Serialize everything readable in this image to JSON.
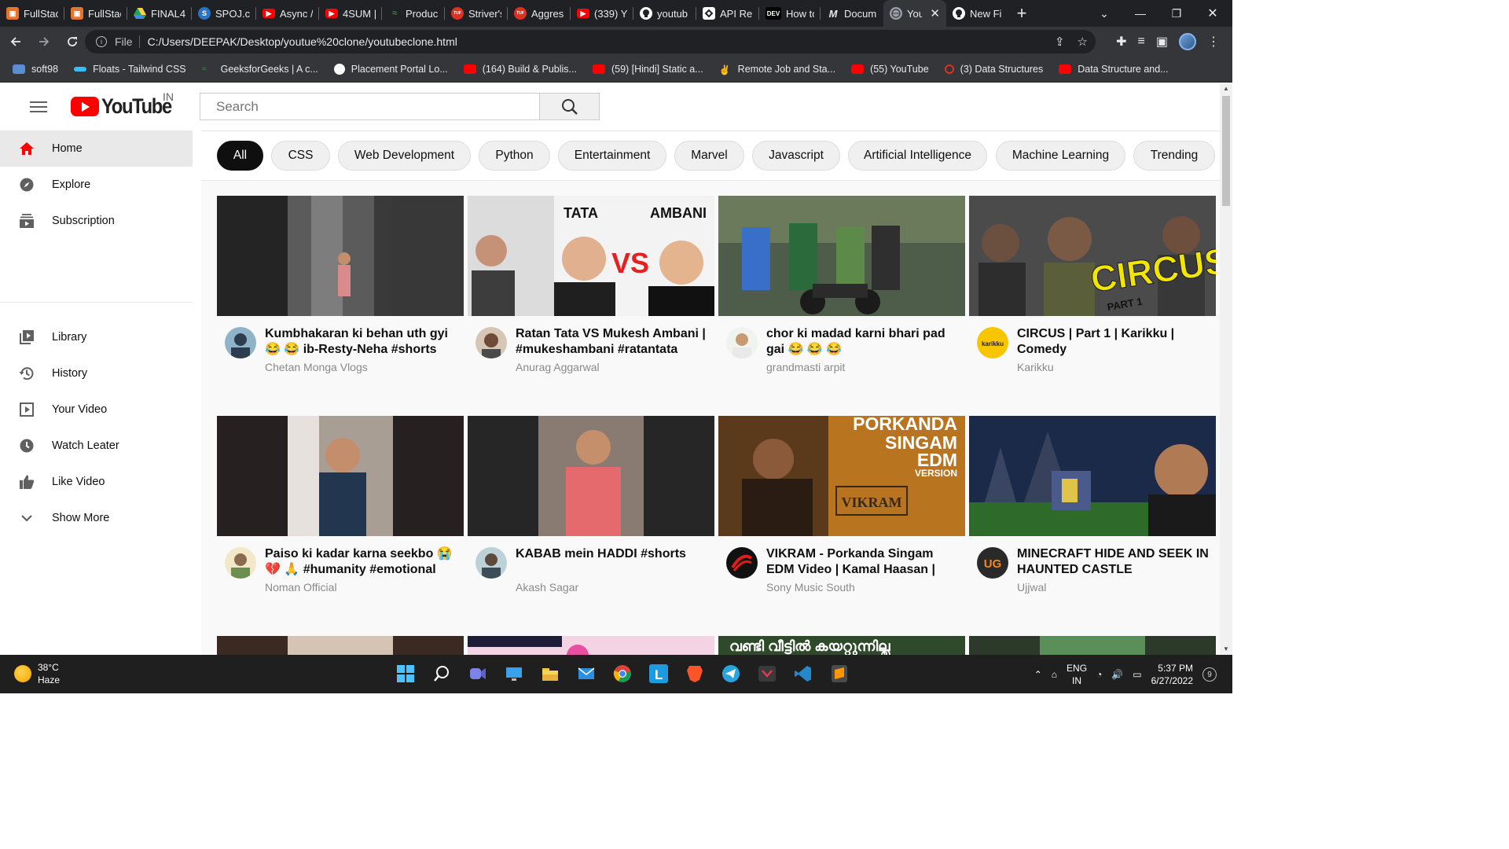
{
  "browser": {
    "tabs": [
      {
        "label": "FullStac",
        "icon": "fullstack-icon",
        "color": "#e8742c"
      },
      {
        "label": "FullStac",
        "icon": "fullstack-icon",
        "color": "#e8742c"
      },
      {
        "label": "FINAL4",
        "icon": "drive-icon",
        "color": "#1fa463"
      },
      {
        "label": "SPOJ.c",
        "icon": "spoj-icon",
        "color": "#2a74c8"
      },
      {
        "label": "Async /",
        "icon": "youtube-icon",
        "color": "#ff0000"
      },
      {
        "label": "4SUM |",
        "icon": "youtube-icon",
        "color": "#ff0000"
      },
      {
        "label": "Produc",
        "icon": "gfg-icon",
        "color": "#2f8d46"
      },
      {
        "label": "Striver's",
        "icon": "tuf-icon",
        "color": "#e0301e"
      },
      {
        "label": "Aggres",
        "icon": "tuf-icon",
        "color": "#e0301e"
      },
      {
        "label": "(339) Y",
        "icon": "youtube-icon",
        "color": "#ff0000"
      },
      {
        "label": "youtub",
        "icon": "github-icon",
        "color": "#ffffff"
      },
      {
        "label": "API Re",
        "icon": "api-icon",
        "color": "#ffffff"
      },
      {
        "label": "How to",
        "icon": "dev-icon",
        "color": "#000000"
      },
      {
        "label": "Docum",
        "icon": "mdn-icon",
        "color": "#202124"
      },
      {
        "label": "You",
        "icon": "globe-icon",
        "color": "#9aa0a6"
      },
      {
        "label": "New Fi",
        "icon": "github-icon",
        "color": "#ffffff"
      }
    ],
    "dev_badge": "DEV",
    "mdn_badge": "M",
    "tuf_badge": "TUF",
    "new_tab_label": "+",
    "address": {
      "scheme_label": "File",
      "url": "C:/Users/DEEPAK/Desktop/youtue%20clone/youtubeclone.html"
    },
    "bookmarks": [
      {
        "label": "soft98",
        "color": "#5b8dd6"
      },
      {
        "label": "Floats - Tailwind CSS",
        "color": "#38bdf8"
      },
      {
        "label": "GeeksforGeeks | A c...",
        "color": "#2f8d46"
      },
      {
        "label": "Placement Portal Lo...",
        "color": "#ffffff"
      },
      {
        "label": "(164) Build & Publis...",
        "color": "#ff0000"
      },
      {
        "label": "(59) [Hindi] Static a...",
        "color": "#ff0000"
      },
      {
        "label": "Remote Job and Sta...",
        "color": "#dddddd"
      },
      {
        "label": "(55) YouTube",
        "color": "#ff0000"
      },
      {
        "label": "(3) Data Structures",
        "color": "#e0301e"
      },
      {
        "label": "Data Structure and...",
        "color": "#ff0000"
      }
    ]
  },
  "youtube": {
    "logo_text": "YouTube",
    "country_code": "IN",
    "search_placeholder": "Search",
    "sidebar": {
      "items": [
        {
          "label": "Home",
          "icon": "home-icon",
          "active": true
        },
        {
          "label": "Explore",
          "icon": "compass-icon"
        },
        {
          "label": "Subscription",
          "icon": "subscriptions-icon"
        },
        {
          "label": "Library",
          "icon": "library-icon"
        },
        {
          "label": "History",
          "icon": "history-icon"
        },
        {
          "label": "Your Video",
          "icon": "your-video-icon"
        },
        {
          "label": "Watch Leater",
          "icon": "clock-icon"
        },
        {
          "label": "Like Video",
          "icon": "thumbs-up-icon"
        },
        {
          "label": "Show More",
          "icon": "chevron-down-icon"
        }
      ]
    },
    "chips": [
      "All",
      "CSS",
      "Web Development",
      "Python",
      "Entertainment",
      "Marvel",
      "Javascript",
      "Artificial Intelligence",
      "Machine Learning",
      "Trending"
    ],
    "videos": [
      {
        "title": "Kumbhakaran ki behan uth gyi 😂 😂 ib-Resty-Neha #shorts",
        "channel": "Chetan Monga Vlogs"
      },
      {
        "title": "Ratan Tata VS Mukesh Ambani | #mukeshambani #ratantata",
        "channel": "Anurag Aggarwal",
        "thumb_words": [
          "TATA",
          "AMBANI",
          "VS"
        ]
      },
      {
        "title": "chor ki madad karni bhari pad gai 😂 😂 😂",
        "channel": "grandmasti arpit"
      },
      {
        "title": "CIRCUS | Part 1 | Karikku | Comedy",
        "channel": "Karikku",
        "thumb_words": [
          "CIRCUS",
          "PART 1"
        ],
        "avatar_text": "karikku"
      },
      {
        "title": "Paiso ki kadar karna seekbo 😭 💔 🙏 #humanity #emotional",
        "channel": "Noman Official"
      },
      {
        "title": "KABAB mein HADDI #shorts",
        "channel": "Akash Sagar"
      },
      {
        "title": "VIKRAM - Porkanda Singam EDM Video | Kamal Haasan |",
        "channel": "Sony Music South",
        "thumb_words": [
          "PORKANDA",
          "SINGAM",
          "EDM",
          "VERSION",
          "VIKRAM"
        ]
      },
      {
        "title": "MINECRAFT HIDE AND SEEK IN HAUNTED CASTLE",
        "channel": "Ujjwal",
        "avatar_text": "UG"
      }
    ],
    "partial_row_text": "വണ്ടി വീട്ടിൽ കയറ്റുന്നില്ല"
  },
  "taskbar": {
    "weather_temp": "38°C",
    "weather_desc": "Haze",
    "lang_top": "ENG",
    "lang_bottom": "IN",
    "time": "5:37 PM",
    "date": "6/27/2022",
    "notifications": "9"
  }
}
